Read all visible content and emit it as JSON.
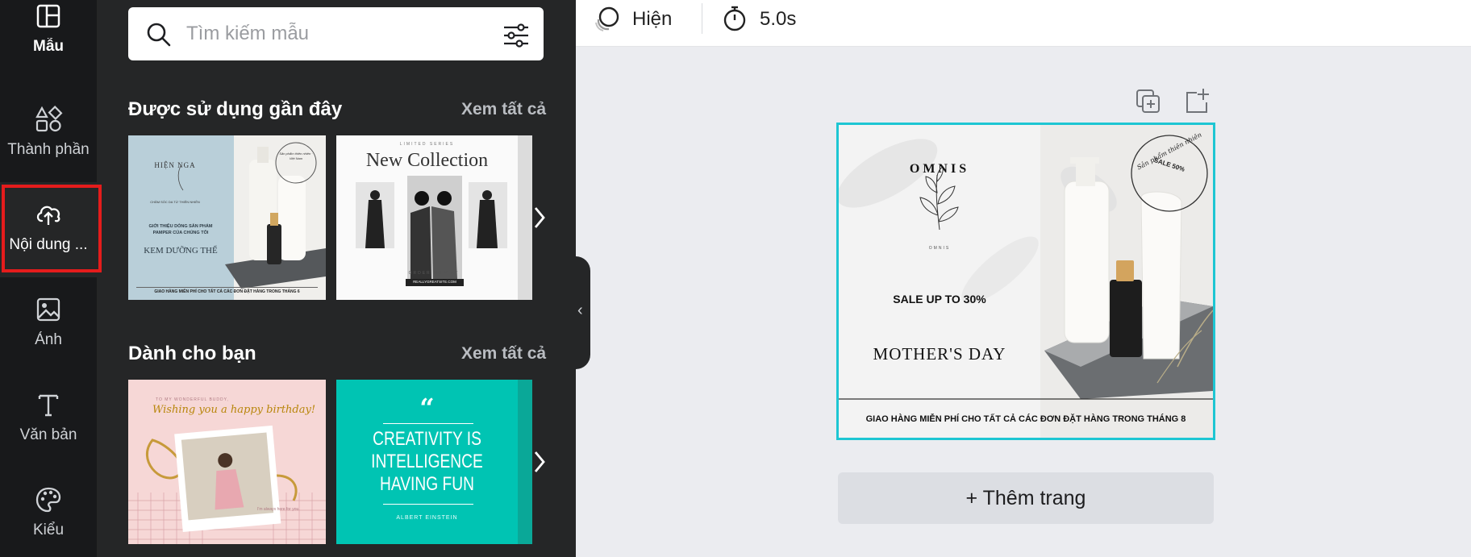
{
  "rail": {
    "items": [
      {
        "label": "Mẫu",
        "icon": "template-icon"
      },
      {
        "label": "Thành phần",
        "icon": "elements-icon"
      },
      {
        "label": "Nội dung ...",
        "icon": "cloud-upload-icon"
      },
      {
        "label": "Ảnh",
        "icon": "image-icon"
      },
      {
        "label": "Văn bản",
        "icon": "text-icon"
      },
      {
        "label": "Kiểu",
        "icon": "palette-icon"
      }
    ]
  },
  "search": {
    "placeholder": "Tìm kiếm mẫu"
  },
  "recent": {
    "title": "Được sử dụng gần đây",
    "see_all": "Xem tất cả",
    "t1": {
      "brand": "HIỆN NGA",
      "brand_sub": "CHĂM SÓC DA TỪ THIÊN NHIÊN",
      "stamp": "Sản phẩm thiên nhiên · Việt Nam",
      "intro": "GIỚI THIỆU DÒNG SẢN PHẨM",
      "intro2": "PAMPER CỦA CHÚNG TÔI",
      "product": "KEM DƯỠNG THỂ",
      "footer": "GIAO HÀNG MIỄN PHÍ CHO TẤT CẢ CÁC ĐƠN ĐẶT HÀNG TRONG THÁNG 6"
    },
    "t2": {
      "kicker": "LIMITED SERIES",
      "title": "New Collection",
      "order": "ORDER NOW AT",
      "url": "REALLYGREATSITE.COM"
    }
  },
  "foryou": {
    "title": "Dành cho bạn",
    "see_all": "Xem tất cả",
    "t3": {
      "kicker": "TO MY WONDERFUL BUDDY,",
      "script": "Wishing you a happy birthday!",
      "note": "I'm always here for you."
    },
    "t4": {
      "quote_mark": "“",
      "line1": "CREATIVITY IS",
      "line2": "INTELLIGENCE",
      "line3": "HAVING FUN",
      "author": "ALBERT EINSTEIN"
    }
  },
  "topbar": {
    "visibility": "Hiện",
    "duration": "5.0s"
  },
  "design": {
    "brand": "OMNIS",
    "brand_small": "OMNIS",
    "sale": "SALE UP TO 30%",
    "title": "MOTHER'S DAY",
    "stamp_outer": "Sản phẩm thiên nhiên",
    "stamp_inner": "SALE 50%",
    "footer": "GIAO HÀNG MIỄN PHÍ CHO TẤT CẢ CÁC ĐƠN ĐẶT HÀNG TRONG THÁNG 8"
  },
  "add_page": "+ Thêm trang",
  "colors": {
    "highlight": "#e51c1c",
    "selection": "#1ec6d3",
    "teal": "#00c4b3"
  }
}
